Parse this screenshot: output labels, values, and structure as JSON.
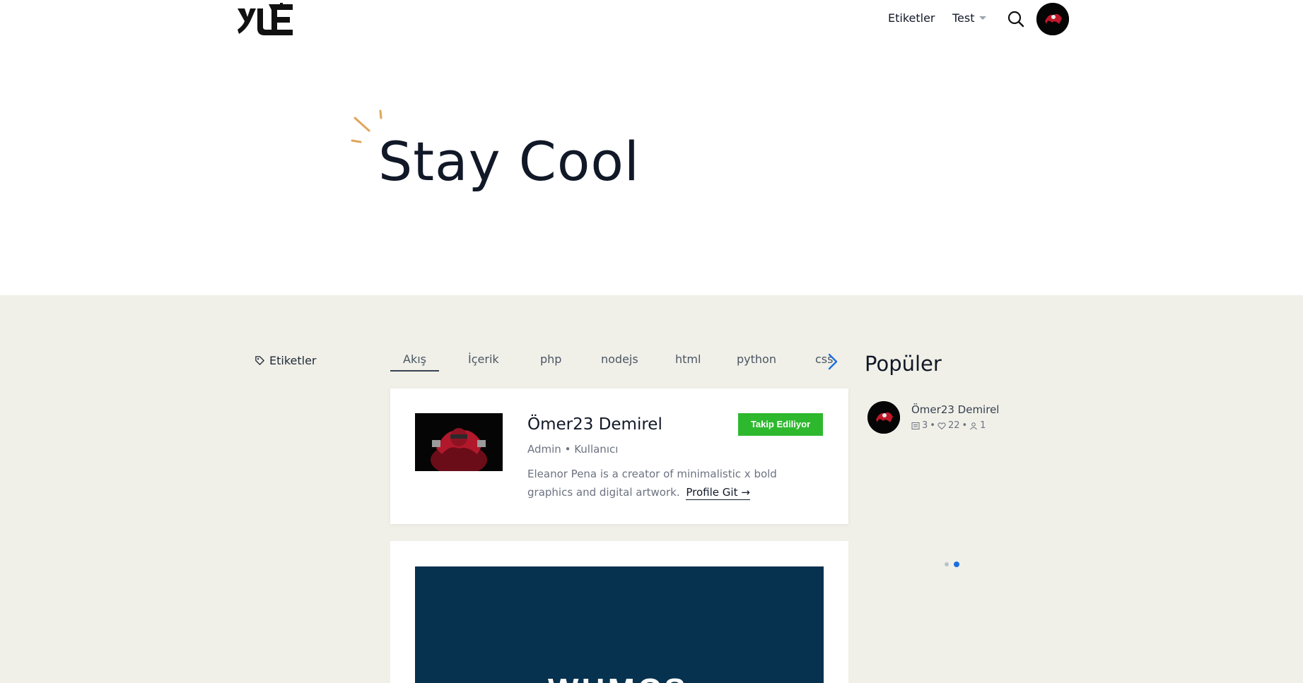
{
  "header": {
    "logo_text": "YUE",
    "nav": {
      "etiketler": "Etiketler",
      "test": "Test"
    },
    "search_icon": "search-icon"
  },
  "hero": {
    "title": "Stay Cool",
    "accent_color": "#e0a55a"
  },
  "main": {
    "background": "#f0f0e8",
    "left": {
      "tags_label": "Etiketler",
      "tags_icon": "tag-icon"
    },
    "tabs": [
      {
        "label": "Akış",
        "active": true
      },
      {
        "label": "İçerik",
        "active": false
      },
      {
        "label": "php",
        "active": false
      },
      {
        "label": "nodejs",
        "active": false
      },
      {
        "label": "html",
        "active": false
      },
      {
        "label": "python",
        "active": false
      },
      {
        "label": "css",
        "active": false
      }
    ],
    "tabs_next_icon": "chevron-right-icon",
    "user_card": {
      "name": "Ömer23 Demirel",
      "role": "Admin • Kullanıcı",
      "follow_label": "Takip Ediliyor",
      "follow_color": "#2eb82e",
      "bio": "Eleanor Pena is a creator of minimalistic x bold graphics and digital artwork.",
      "profile_link": "Profile Git"
    },
    "post_card": {
      "image_text": "WHMCS",
      "image_bg": "#06324f"
    },
    "popular": {
      "title": "Popüler",
      "items": [
        {
          "name": "Ömer23 Demirel",
          "posts": "3",
          "likes": "22",
          "followers": "1"
        }
      ],
      "slide_count": 2,
      "active_slide": 2,
      "dot_active_color": "#1d6fe0"
    }
  }
}
